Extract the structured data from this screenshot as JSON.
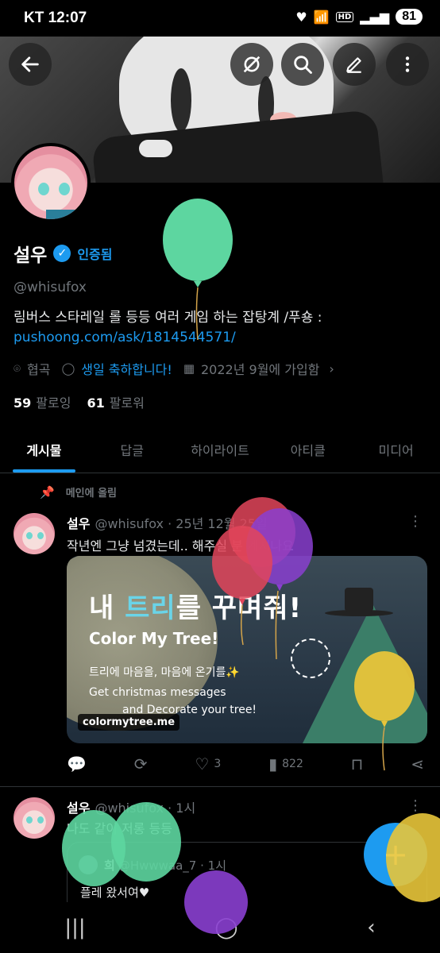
{
  "status_bar": {
    "carrier": "KT",
    "time": "12:07",
    "network_label": "HD",
    "battery": "81"
  },
  "profile": {
    "name": "설우",
    "verified_label": "인증됨",
    "handle": "@whisufox",
    "bio_text": "림버스 스타레일 롤 등등 여러 게임 하는 잡탕계  /푸숑 : ",
    "bio_link": "pushoong.com/ask/1814544571/",
    "location": "협곡",
    "birthday": "생일 축하합니다!",
    "joined": "2022년 9월에 가입함",
    "following_count": "59",
    "following_label": "팔로잉",
    "followers_count": "61",
    "followers_label": "팔로워"
  },
  "tabs": [
    {
      "label": "게시물",
      "active": true
    },
    {
      "label": "답글",
      "active": false
    },
    {
      "label": "하이라이트",
      "active": false
    },
    {
      "label": "아티클",
      "active": false
    },
    {
      "label": "미디어",
      "active": false
    }
  ],
  "pinned_label": "메인에 올림",
  "post1": {
    "name": "설우",
    "handle": "@whisufox",
    "time": "· 25년 12월 25일",
    "text": "작년엔 그냥 넘겼는데.. 해주실 분 계시나요",
    "card": {
      "title_part1": "내 ",
      "title_highlight": "트리",
      "title_part2": "를 꾸며줘!",
      "title_en": "Color My Tree!",
      "line1": "트리에 마음을, 마음에 온기를✨",
      "line2": "Get christmas messages",
      "line3": "and Decorate your tree!",
      "domain": "colormytree.me"
    },
    "likes": "3",
    "views": "822"
  },
  "post2": {
    "name": "설우",
    "handle": "@whisufox",
    "time": "· 1시",
    "text": "나도 같이 저롱 등등",
    "quote": {
      "name": "희",
      "handle": "@Hwwwaa_7",
      "time": "· 1시",
      "text": "플레 왔서여♥"
    }
  },
  "colors": {
    "accent": "#1d9bf0",
    "balloon_green": "#5dd6a0",
    "balloon_red": "#e2455a",
    "balloon_purple": "#8a3fd0",
    "balloon_yellow": "#e8c53a"
  },
  "icons": {
    "back": "arrow-left-icon",
    "no_translate": "slash-circle-icon",
    "search": "search-icon",
    "edit": "pencil-icon",
    "more": "more-vertical-icon",
    "compose": "plus-icon"
  }
}
